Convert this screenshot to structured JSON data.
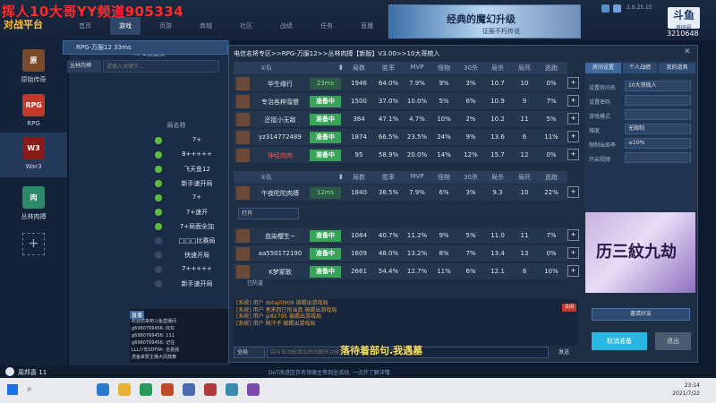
{
  "stream": {
    "title": "挥人10大哥YY频道905334"
  },
  "app": {
    "logo": "对战平台",
    "nav": [
      "首页",
      "游戏",
      "页游",
      "商城",
      "社区",
      "战绩",
      "任务",
      "直播"
    ],
    "version": "2.0.25.15",
    "banner_title": "经典的魔幻升级",
    "banner_sub": "征服不朽传说"
  },
  "room_badge": {
    "logo": "斗鱼",
    "label": "房间号",
    "number": "3210648"
  },
  "rail": [
    {
      "label": "原始传奇",
      "icon": "原"
    },
    {
      "label": "RPG",
      "icon": "RPG"
    },
    {
      "label": "War3",
      "icon": "W3"
    },
    {
      "label": "丛林肉搏",
      "icon": "肉"
    }
  ],
  "lobby": {
    "header": "RPG频道页",
    "room_select": "RPG-万服12 33ms",
    "filter": "丛林肉搏",
    "search_placeholder": "请输入关键字...",
    "col_header": "局名称",
    "rooms": [
      "7+",
      "8+++++",
      "飞天鱼12",
      "新手速开局",
      "7+",
      "7+速开",
      "7+局面全加",
      "□□□比赛局",
      "快速开局",
      "7+++++",
      "新手速开局"
    ],
    "live_label": "直播",
    "chat": [
      "欢迎您来到斗鱼直播间",
      "g6980769456: 红红",
      "g6980769456: 111",
      "g6980769456: 记住",
      "LLL少年SDFWr: 名挑我",
      "虎鱼来赞主播大风鼓舞"
    ]
  },
  "dialog": {
    "title": "电信名将专区>>RPG-万服12>>丛林肉搏【新版】V3.00>>10大哥梳人",
    "team1": "①队",
    "team2": "②队",
    "columns": [
      "局数",
      "胜率",
      "MVP",
      "怪物",
      "30杀",
      "局杀",
      "局死",
      "逃跑"
    ],
    "team1_players": [
      {
        "name": "毕生缘行",
        "status": "23ms",
        "ping": true,
        "vals": [
          "1946",
          "64.0%",
          "7.9%",
          "9%",
          "3%",
          "10.7",
          "10",
          "0%"
        ]
      },
      {
        "name": "专治各种溜傻",
        "status": "准备中",
        "ping": false,
        "vals": [
          "1500",
          "37.0%",
          "10.0%",
          "5%",
          "6%",
          "10.9",
          "9",
          "7%"
        ]
      },
      {
        "name": "还挺小无敌",
        "status": "准备中",
        "ping": false,
        "vals": [
          "384",
          "47.1%",
          "4.7%",
          "10%",
          "2%",
          "10.2",
          "11",
          "5%"
        ]
      },
      {
        "name": "yz314772489",
        "status": "准备中",
        "ping": false,
        "vals": [
          "1874",
          "66.5%",
          "23.5%",
          "24%",
          "9%",
          "13.6",
          "6",
          "11%"
        ]
      },
      {
        "name": "神经肉肉",
        "status": "准备中",
        "ping": false,
        "vals": [
          "95",
          "58.9%",
          "20.0%",
          "14%",
          "12%",
          "15.7",
          "12",
          "0%"
        ]
      }
    ],
    "team2_players": [
      {
        "name": "午夜陀陀肉搏",
        "status": "12ms",
        "ping": true,
        "vals": [
          "1840",
          "38.5%",
          "7.9%",
          "6%",
          "3%",
          "9.3",
          "10",
          "22%"
        ]
      },
      {
        "name": "血染樱生~",
        "status": "准备中",
        "ping": false,
        "vals": [
          "1084",
          "40.7%",
          "11.2%",
          "9%",
          "5%",
          "11.0",
          "11",
          "7%"
        ]
      },
      {
        "name": "aa550172190",
        "status": "准备中",
        "ping": false,
        "vals": [
          "1609",
          "48.0%",
          "13.2%",
          "8%",
          "7%",
          "13.4",
          "13",
          "0%"
        ]
      },
      {
        "name": "K梦冢歌",
        "status": "准备中",
        "ping": false,
        "vals": [
          "2661",
          "54.4%",
          "12.7%",
          "11%",
          "6%",
          "12.1",
          "8",
          "10%"
        ]
      }
    ],
    "join_select": "打开",
    "ready_label": "已防盗",
    "settings_tabs": [
      "房间设置",
      "个人战绩",
      "我的道具"
    ],
    "settings": [
      {
        "label": "设置房间名",
        "value": "10大哥梳人"
      },
      {
        "label": "设置密码",
        "value": ""
      },
      {
        "label": "游戏模式",
        "value": ""
      },
      {
        "label": "难度",
        "value": "无限制"
      },
      {
        "label": "限制出局率",
        "value": "≤10%"
      },
      {
        "label": "开启视频",
        "value": ""
      }
    ],
    "promo_title": "历三紋九劫",
    "invite_btn": "邀请好友",
    "cancel_btn": "取消准备",
    "exit_btn": "退出",
    "chatlog": [
      {
        "type": "sys",
        "text": "[系统] 用户 dotaji0909 被踢出游戏局"
      },
      {
        "type": "sys",
        "text": "[系统] 用户 者来而已别当真 被踢出游戏局"
      },
      {
        "type": "sys",
        "text": "[系统] 用户 gi82795 被踢出游戏局"
      },
      {
        "type": "sys",
        "text": "[系统] 用户 网汗子 被踢出游戏局"
      }
    ],
    "chat_close": "关闭",
    "chan_select": "全局",
    "chat_placeholder": "因与自动能增加房间聊天功能暂时关闭,对您造成的不便请谅解。",
    "send_btn": "发送"
  },
  "subtitle": "落待着部句.我遇墓",
  "statusbar": {
    "user": "周邦喜",
    "level": "11",
    "ticker": "DoT改进区存名领源主等到全活动, 一点开了解详情"
  },
  "taskbar": {
    "time": "23:14",
    "date": "2021/7/22"
  }
}
